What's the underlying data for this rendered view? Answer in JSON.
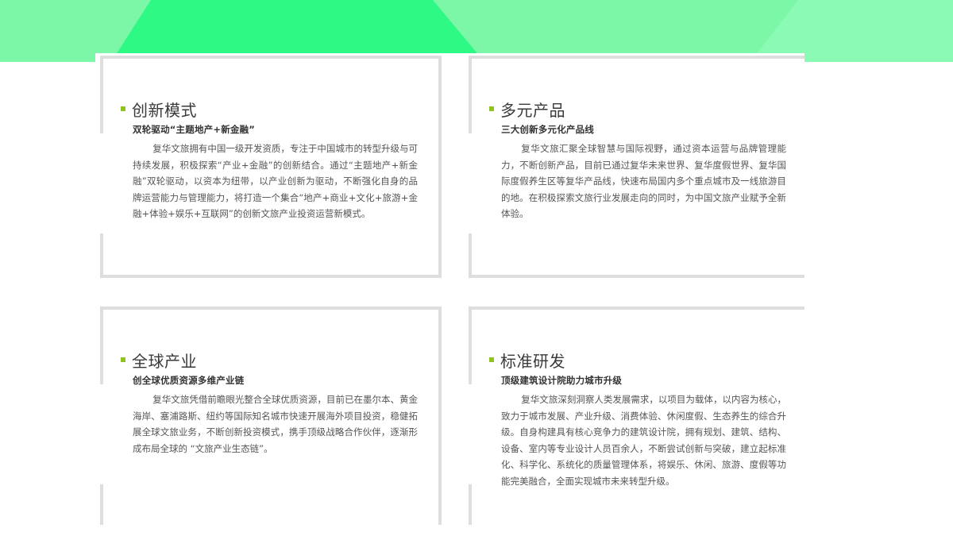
{
  "colors": {
    "banner_light": "#7cf7a8",
    "banner_bright": "#2ef985",
    "accent_bullet": "#8fc31f",
    "frame": "#dedede"
  },
  "cards": [
    {
      "title": "创新模式",
      "subtitle": "双轮驱动“主题地产+新金融”",
      "body": "复华文旅拥有中国一级开发资质，专注于中国城市的转型升级与可持续发展，积极探索“产业+金融”的创新结合。通过“主题地产+新金融”双轮驱动，以资本为纽带，以产业创新为驱动，不断强化自身的品牌运营能力与管理能力，将打造一个集合“地产+商业+文化+旅游+金融+体验+娱乐+互联网”的创新文旅产业投资运营新模式。"
    },
    {
      "title": "多元产品",
      "subtitle": "三大创新多元化产品线",
      "body": "复华文旅汇聚全球智慧与国际视野，通过资本运营与品牌管理能力，不断创新产品，目前已通过复华未来世界、复华度假世界、复华国际度假养生区等复华产品线，快速布局国内多个重点城市及一线旅游目的地。在积极探索文旅行业发展走向的同时，为中国文旅产业赋予全新体验。"
    },
    {
      "title": "全球产业",
      "subtitle": "创全球优质资源多维产业链",
      "body": "复华文旅凭借前瞻眼光整合全球优质资源，目前已在墨尔本、黄金海岸、塞浦路斯、纽约等国际知名城市快速开展海外项目投资，稳健拓展全球文旅业务，不断创新投资模式，携手顶级战略合作伙伴，逐渐形成布局全球的 “文旅产业生态链”。"
    },
    {
      "title": "标准研发",
      "subtitle": "顶级建筑设计院助力城市升级",
      "body": "复华文旅深刻洞察人类发展需求，以项目为载体，以内容为核心，致力于城市发展、产业升级、消费体验、休闲度假、生态养生的综合升级。自身构建具有核心竞争力的建筑设计院，拥有规划、建筑、结构、设备、室内等专业设计人员百余人，不断尝试创新与突破，建立起标准化、科学化、系统化的质量管理体系，将娱乐、休闲、旅游、度假等功能完美融合，全面实现城市未来转型升级。"
    }
  ]
}
